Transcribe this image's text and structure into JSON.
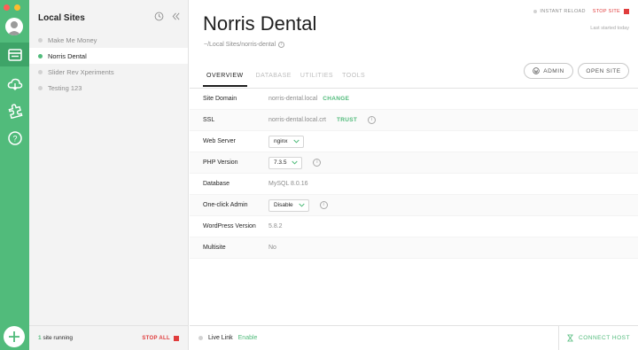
{
  "sidebar": {
    "title": "Local Sites",
    "sites": [
      {
        "name": "Make Me Money",
        "active": false
      },
      {
        "name": "Norris Dental",
        "active": true
      },
      {
        "name": "Slider Rev Xperiments",
        "active": false
      },
      {
        "name": "Testing 123",
        "active": false
      }
    ],
    "running_count": "1",
    "running_text": "site running",
    "stop_all": "STOP ALL"
  },
  "site": {
    "title": "Norris Dental",
    "path": "~/Local Sites/norris-dental",
    "instant_reload": "INSTANT RELOAD",
    "stop_site": "STOP SITE",
    "last_started": "Last started today"
  },
  "tabs": [
    "OVERVIEW",
    "DATABASE",
    "UTILITIES",
    "TOOLS"
  ],
  "buttons": {
    "admin": "ADMIN",
    "open_site": "OPEN SITE"
  },
  "overview": {
    "site_domain": {
      "label": "Site Domain",
      "value": "norris-dental.local",
      "action": "CHANGE"
    },
    "ssl": {
      "label": "SSL",
      "value": "norris-dental.local.crt",
      "action": "TRUST"
    },
    "web_server": {
      "label": "Web Server",
      "value": "nginx"
    },
    "php_version": {
      "label": "PHP Version",
      "value": "7.3.5"
    },
    "database": {
      "label": "Database",
      "value": "MySQL 8.0.16"
    },
    "one_click_admin": {
      "label": "One-click Admin",
      "value": "Disable"
    },
    "wordpress_version": {
      "label": "WordPress Version",
      "value": "5.8.2"
    },
    "multisite": {
      "label": "Multisite",
      "value": "No"
    }
  },
  "footer": {
    "live_link": "Live Link",
    "enable": "Enable",
    "connect_host": "CONNECT HOST"
  },
  "colors": {
    "accent": "#51bb7b",
    "danger": "#e03c3c"
  },
  "icons": {
    "rail": [
      "avatar",
      "sites-icon",
      "cloud-icon",
      "addons-icon",
      "help-icon",
      "add-icon"
    ],
    "sidebar_header": [
      "history-icon",
      "collapse-icon"
    ]
  }
}
